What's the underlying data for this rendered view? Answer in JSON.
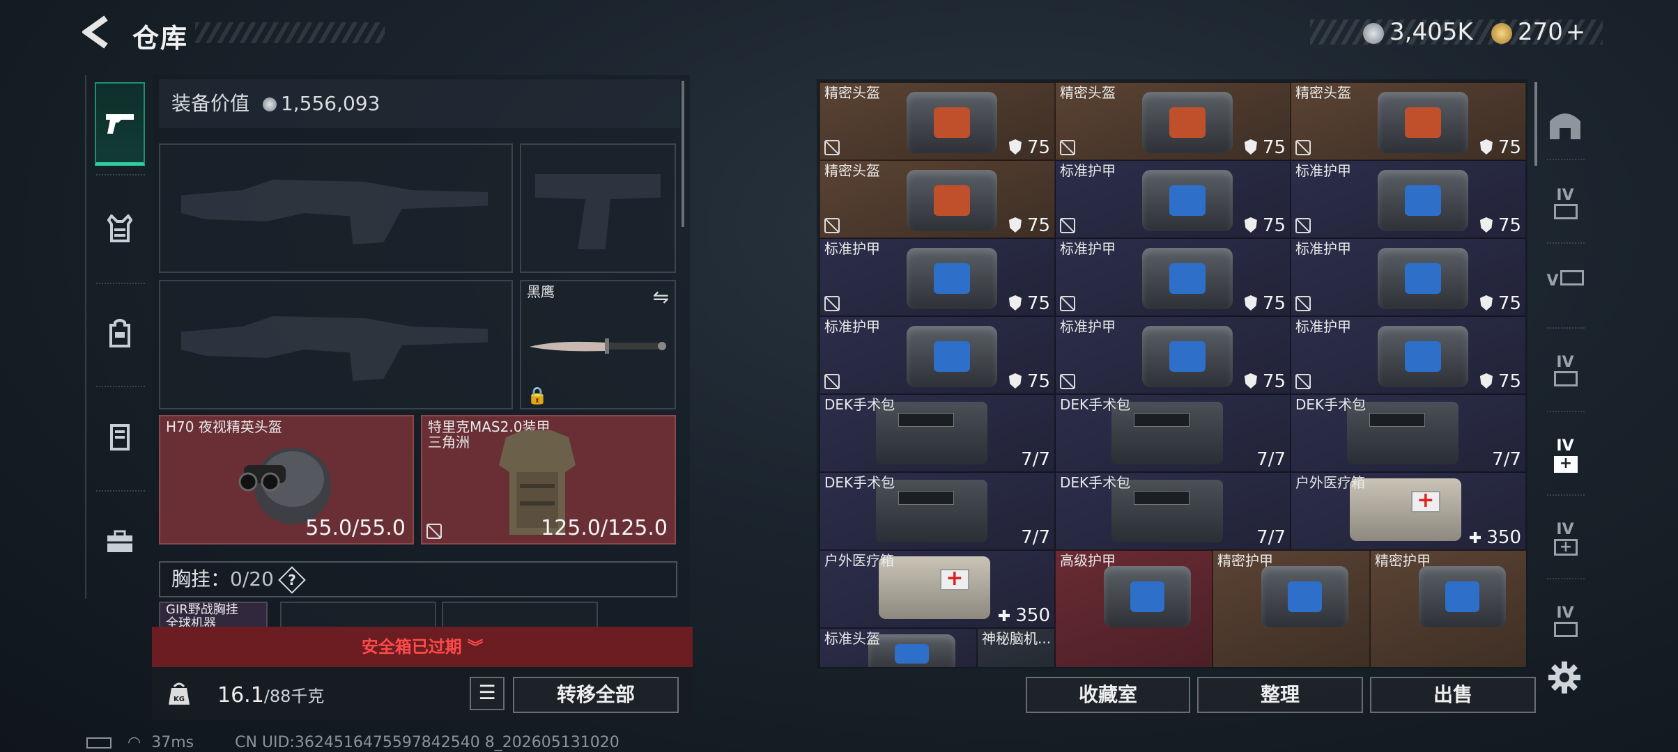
{
  "header": {
    "title": "仓库"
  },
  "currency": {
    "silver": "3,405K",
    "gold": "270"
  },
  "left_nav": [
    "gun-icon",
    "vest-icon",
    "backpack-icon",
    "locker-icon",
    "briefcase-icon"
  ],
  "equipment": {
    "value_label": "装备价值",
    "value": "1,556,093",
    "melee_name": "黑鹰",
    "helmet_name": "H70 夜视精英头盔",
    "helmet_value": "55.0/55.0",
    "armor_name": "特里克MAS2.0装甲",
    "armor_sub": "三角洲",
    "armor_value": "125.0/125.0",
    "rig_label": "胸挂：",
    "rig_value": "0/20",
    "rig_help": "?",
    "rig_item": "GIR野战胸挂",
    "rig_item_sub": "全球机器"
  },
  "safebox": {
    "expired": "安全箱已过期"
  },
  "bottom": {
    "weight": "16.1",
    "weight_max": "/88千克",
    "transfer_all": "转移全部"
  },
  "stash": {
    "items": [
      {
        "name": "精密头盔",
        "value": "75",
        "color": "orange",
        "kind": "bag",
        "screen": "#c0502c"
      },
      {
        "name": "精密头盔",
        "value": "75",
        "color": "orange",
        "kind": "bag",
        "screen": "#c0502c"
      },
      {
        "name": "精密头盔",
        "value": "75",
        "color": "orange",
        "kind": "bag",
        "screen": "#c0502c"
      },
      {
        "name": "精密头盔",
        "value": "75",
        "color": "orange",
        "kind": "bag",
        "screen": "#c0502c"
      },
      {
        "name": "标准护甲",
        "value": "75",
        "color": "purple",
        "kind": "bag",
        "screen": "#2d6fc9"
      },
      {
        "name": "标准护甲",
        "value": "75",
        "color": "purple",
        "kind": "bag",
        "screen": "#2d6fc9"
      },
      {
        "name": "标准护甲",
        "value": "75",
        "color": "purple",
        "kind": "bag",
        "screen": "#2d6fc9"
      },
      {
        "name": "标准护甲",
        "value": "75",
        "color": "purple",
        "kind": "bag",
        "screen": "#2d6fc9"
      },
      {
        "name": "标准护甲",
        "value": "75",
        "color": "purple",
        "kind": "bag",
        "screen": "#2d6fc9"
      },
      {
        "name": "标准护甲",
        "value": "75",
        "color": "purple",
        "kind": "bag",
        "screen": "#2d6fc9"
      },
      {
        "name": "标准护甲",
        "value": "75",
        "color": "purple",
        "kind": "bag",
        "screen": "#2d6fc9"
      },
      {
        "name": "标准护甲",
        "value": "75",
        "color": "purple",
        "kind": "bag",
        "screen": "#2d6fc9"
      },
      {
        "name": "DEK手术包",
        "value": "7/7",
        "color": "purple",
        "kind": "kit"
      },
      {
        "name": "DEK手术包",
        "value": "7/7",
        "color": "purple",
        "kind": "kit"
      },
      {
        "name": "DEK手术包",
        "value": "7/7",
        "color": "purple",
        "kind": "kit"
      },
      {
        "name": "DEK手术包",
        "value": "7/7",
        "color": "purple",
        "kind": "kit"
      },
      {
        "name": "DEK手术包",
        "value": "7/7",
        "color": "purple",
        "kind": "kit"
      },
      {
        "name": "户外医疗箱",
        "value": "350",
        "color": "purple",
        "kind": "box"
      },
      {
        "name": "户外医疗箱",
        "value": "350",
        "color": "purple",
        "kind": "box"
      },
      {
        "name": "高级护甲",
        "value": "",
        "color": "red",
        "kind": "bag",
        "screen": "#2d6fc9"
      },
      {
        "name": "精密护甲",
        "value": "",
        "color": "orange",
        "kind": "bag",
        "screen": "#2d6fc9"
      },
      {
        "name": "精密护甲",
        "value": "",
        "color": "orange",
        "kind": "bag",
        "screen": "#2d6fc9"
      },
      {
        "name": "标准头盔",
        "value": "",
        "color": "purple",
        "kind": "bag",
        "screen": "#2d6fc9"
      },
      {
        "name": "神秘脑机...",
        "value": "",
        "color": "gray",
        "kind": "none"
      }
    ],
    "buttons": {
      "collection": "收藏室",
      "organize": "整理",
      "sell": "出售"
    }
  },
  "right_nav": [
    "house-icon",
    "container-4-icon",
    "container-5-icon",
    "container-6-icon",
    "medkit-4-icon",
    "medkit-5-icon",
    "container-7-icon"
  ],
  "status": {
    "ping": "37ms",
    "uid": "CN UID:3624516475597842540 8_202605131020"
  }
}
